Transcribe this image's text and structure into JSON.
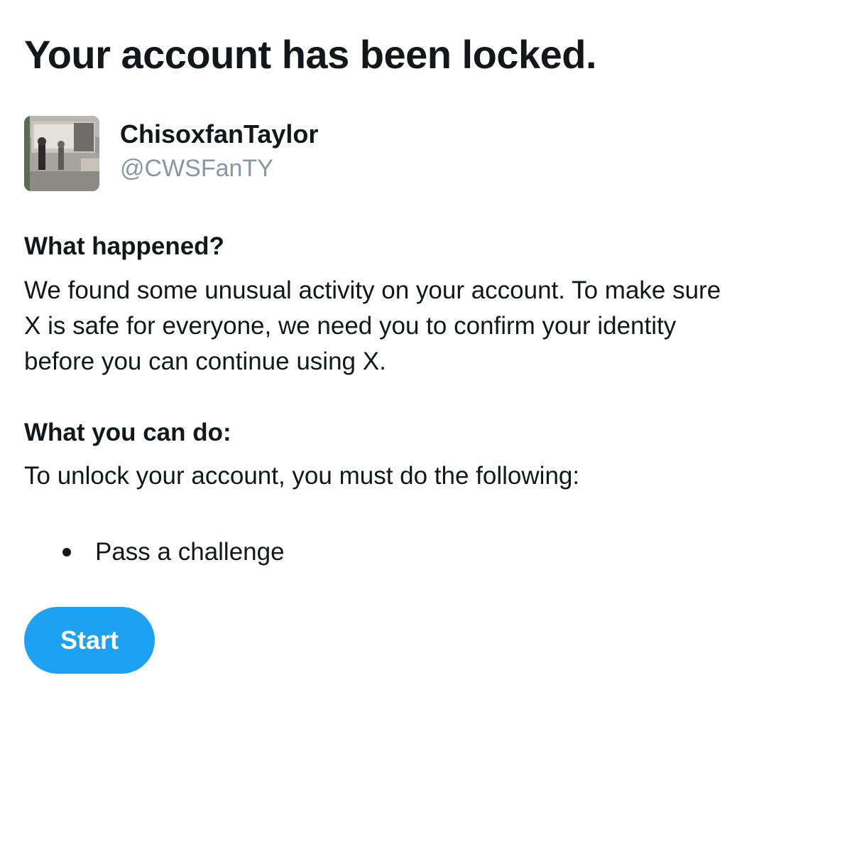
{
  "page": {
    "title": "Your account has been locked."
  },
  "account": {
    "display_name": "ChisoxfanTaylor",
    "handle": "@CWSFanTY",
    "avatar_icon": "profile-photo"
  },
  "what_happened": {
    "heading": "What happened?",
    "lines": [
      "We found some unusual activity on your account. To make sure",
      "X is safe for everyone, we need you to confirm your identity",
      "before you can continue using X."
    ]
  },
  "what_you_can_do": {
    "heading": "What you can do:",
    "body": "To unlock your account, you must do the following:",
    "steps": [
      "Pass a challenge"
    ]
  },
  "actions": {
    "start_label": "Start"
  },
  "colors": {
    "text": "#14171a",
    "secondary_text": "#8a96a3",
    "accent": "#1da1f2",
    "background": "#ffffff"
  }
}
